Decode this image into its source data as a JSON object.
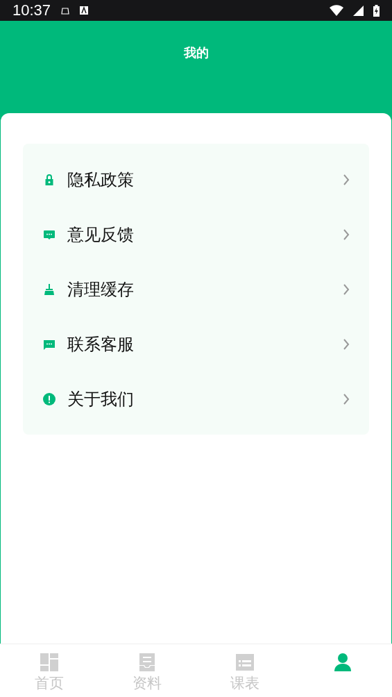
{
  "status_bar": {
    "time": "10:37"
  },
  "header": {
    "title": "我的"
  },
  "menu": [
    {
      "label": "隐私政策",
      "kind": "lock"
    },
    {
      "label": "意见反馈",
      "kind": "feedback"
    },
    {
      "label": "清理缓存",
      "kind": "broom"
    },
    {
      "label": "联系客服",
      "kind": "message"
    },
    {
      "label": "关于我们",
      "kind": "info"
    }
  ],
  "tabs": [
    {
      "label": "首页",
      "kind": "home",
      "selected": false
    },
    {
      "label": "资料",
      "kind": "docs",
      "selected": false
    },
    {
      "label": "课表",
      "kind": "schedule",
      "selected": false
    },
    {
      "kind": "mine",
      "selected": true
    }
  ]
}
